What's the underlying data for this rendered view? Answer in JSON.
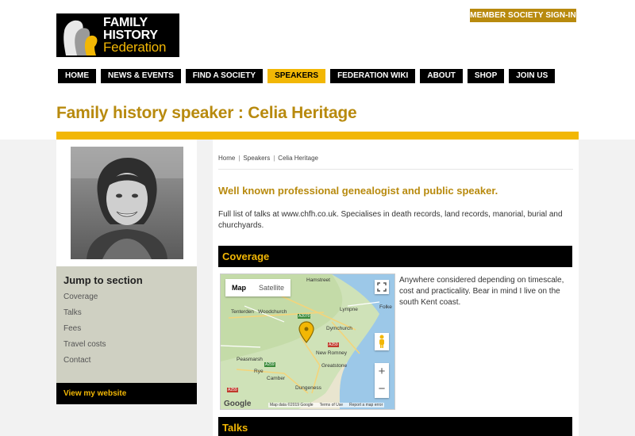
{
  "header": {
    "logo": {
      "line1": "FAMILY",
      "line2": "HISTORY",
      "line3": "Federation"
    },
    "signin_label": "MEMBER SOCIETY SIGN-IN",
    "nav": [
      {
        "label": "HOME",
        "active": false
      },
      {
        "label": "NEWS & EVENTS",
        "active": false
      },
      {
        "label": "FIND A SOCIETY",
        "active": false
      },
      {
        "label": "SPEAKERS",
        "active": true
      },
      {
        "label": "FEDERATION WIKI",
        "active": false
      },
      {
        "label": "ABOUT",
        "active": false
      },
      {
        "label": "SHOP",
        "active": false
      },
      {
        "label": "JOIN US",
        "active": false
      }
    ]
  },
  "page": {
    "title": "Family history speaker : Celia Heritage"
  },
  "sidebar": {
    "jump_title": "Jump to section",
    "jump_links": [
      "Coverage",
      "Talks",
      "Fees",
      "Travel costs",
      "Contact"
    ],
    "website_label": "View my website"
  },
  "main": {
    "breadcrumb": [
      "Home",
      "Speakers",
      "Celia Heritage"
    ],
    "breadcrumb_sep": "|",
    "lead": "Well known professional genealogist and public speaker.",
    "description": "Full list of talks at www.chfh.co.uk. Specialises in death records, land records, manorial, burial and churchyards.",
    "coverage_heading": "Coverage",
    "coverage_text": "Anywhere considered depending on timescale, cost and practicality. Bear in mind I live on the south Kent coast.",
    "talks_heading": "Talks",
    "map": {
      "toggle_map": "Map",
      "toggle_satellite": "Satellite",
      "footer": [
        "Map data ©2019 Google",
        "Terms of Use",
        "Report a map error"
      ],
      "google": "Google",
      "places": [
        "Tenterden",
        "Woodchurch",
        "Lympne",
        "Folke",
        "Dymchurch",
        "New Romney",
        "Greatstone",
        "Peasmarsh",
        "Rye",
        "Camber",
        "Dungeness",
        "Hamstreet"
      ],
      "roads": [
        "A2070",
        "A259",
        "A259",
        "A259"
      ]
    }
  },
  "colors": {
    "accent": "#f2b705",
    "accent_dark": "#b88a0e",
    "nav_bg": "#000000",
    "sidebar_bg": "#cfd0c2"
  }
}
